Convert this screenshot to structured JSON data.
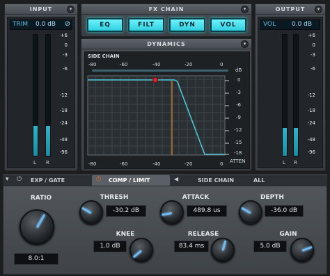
{
  "input": {
    "title": "INPUT",
    "trim_label": "TRIM",
    "trim_value": "0.0 dB",
    "scale": [
      "+6",
      "0",
      "-3",
      "-6",
      "-12",
      "-18",
      "-24",
      "-48",
      "-96"
    ],
    "channels": [
      "L",
      "R"
    ],
    "levels": [
      0.25,
      0.25
    ]
  },
  "fx_chain": {
    "title": "FX CHAIN",
    "buttons": [
      "EQ",
      "FILT",
      "DYN",
      "VOL"
    ]
  },
  "output": {
    "title": "OUTPUT",
    "vol_label": "VOL",
    "vol_value": "0.0 dB",
    "scale": [
      "+6",
      "0",
      "-3",
      "-6",
      "-12",
      "-18",
      "-24",
      "-48",
      "-96"
    ],
    "channels": [
      "L",
      "R"
    ],
    "levels": [
      0.23,
      0.23
    ]
  },
  "dynamics": {
    "title": "DYNAMICS",
    "side_chain_label": "SIDE CHAIN",
    "top_ticks": [
      "-80",
      "-60",
      "-40",
      "-20",
      "0"
    ],
    "bottom_ticks": [
      "-80",
      "-60",
      "-40",
      "-20",
      "0"
    ],
    "db_label": "dB",
    "right_ticks": [
      "0",
      "-3",
      "-6",
      "-9",
      "-12",
      "-15",
      "-18"
    ],
    "atten_label": "ATTEN"
  },
  "tabs": {
    "exp_gate": "EXP / GATE",
    "comp_limit": "COMP / LIMIT",
    "side_chain": "SIDE CHAIN",
    "all": "ALL"
  },
  "controls": {
    "ratio": {
      "label": "RATIO",
      "value": "8.0:1"
    },
    "thresh": {
      "label": "THRESH",
      "value": "-30.2 dB"
    },
    "knee": {
      "label": "KNEE",
      "value": "1.0 dB"
    },
    "attack": {
      "label": "ATTACK",
      "value": "489.8 us"
    },
    "release": {
      "label": "RELEASE",
      "value": "83.4 ms"
    },
    "depth": {
      "label": "DEPTH",
      "value": "-36.0 dB"
    },
    "gain": {
      "label": "GAIN",
      "value": "5.0 dB"
    }
  },
  "colors": {
    "accent": "#2fd0e2",
    "meter": "#1a8ea3",
    "curve": "#4fc7d8",
    "threshold_line": "#e08a2a",
    "power_icon": "#e8632a"
  },
  "icons": [
    "chevron-down-icon",
    "power-icon",
    "speaker-icon",
    "link-off-icon"
  ]
}
